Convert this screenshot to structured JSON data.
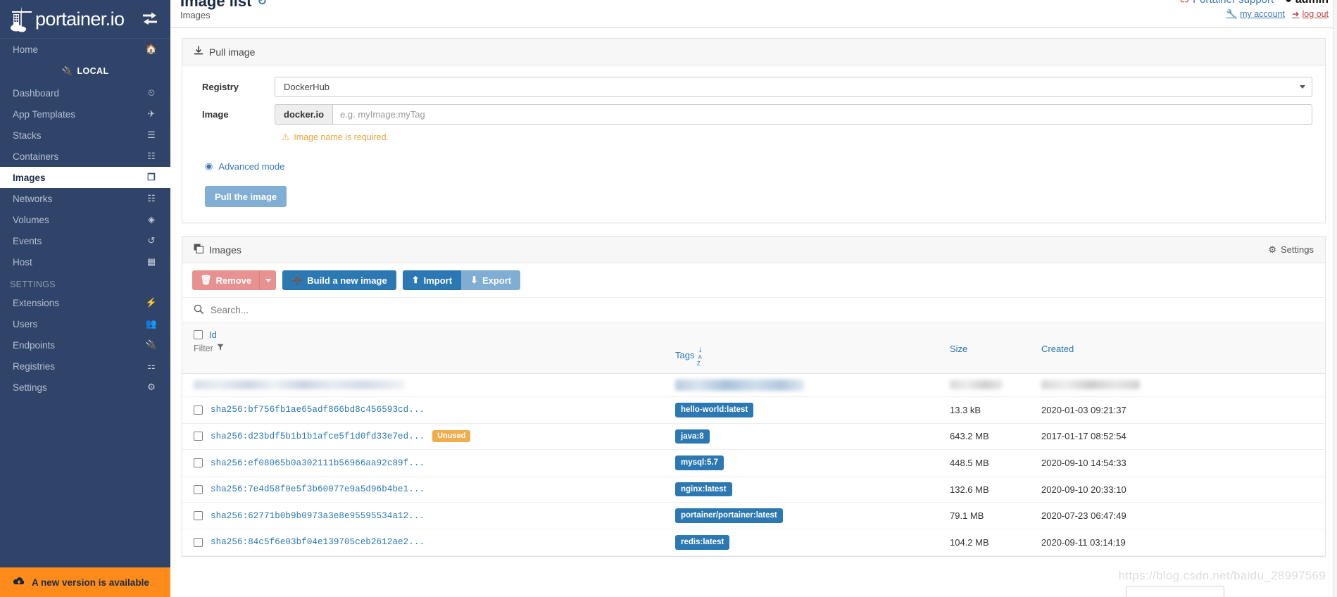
{
  "sidebar": {
    "brand": "portainer.io",
    "toggle_icon": "toggle-sidebar-icon",
    "home_label": "Home",
    "endpoint_label": "LOCAL",
    "settings_section_label": "SETTINGS",
    "items": [
      {
        "label": "Dashboard",
        "icon": "dashboard-icon"
      },
      {
        "label": "App Templates",
        "icon": "rocket-icon"
      },
      {
        "label": "Stacks",
        "icon": "list-icon"
      },
      {
        "label": "Containers",
        "icon": "server-icon"
      },
      {
        "label": "Images",
        "icon": "clone-icon"
      },
      {
        "label": "Networks",
        "icon": "sitemap-icon"
      },
      {
        "label": "Volumes",
        "icon": "cubes-icon"
      },
      {
        "label": "Events",
        "icon": "history-icon"
      },
      {
        "label": "Host",
        "icon": "th-icon"
      }
    ],
    "settings_items": [
      {
        "label": "Extensions",
        "icon": "bolt-icon"
      },
      {
        "label": "Users",
        "icon": "users-icon"
      },
      {
        "label": "Endpoints",
        "icon": "plug-icon"
      },
      {
        "label": "Registries",
        "icon": "database-icon"
      },
      {
        "label": "Settings",
        "icon": "cogs-icon"
      }
    ],
    "active_item": "Images",
    "new_version_label": "A new version is available"
  },
  "header": {
    "title": "Image list",
    "refresh_icon": "refresh-icon",
    "subtitle": "Images",
    "support_label": "Portainer support",
    "user_label": "admin",
    "my_account_label": "my account",
    "logout_label": "log out"
  },
  "pull_panel": {
    "title": "Pull image",
    "title_icon": "download-icon",
    "registry_label": "Registry",
    "registry_value": "DockerHub",
    "image_label": "Image",
    "image_prefix": "docker.io",
    "image_placeholder": "e.g. myImage:myTag",
    "image_value": "",
    "warning": "Image name is required.",
    "advanced_mode_label": "Advanced mode",
    "advanced_mode_icon": "globe-icon",
    "pull_button_label": "Pull the image"
  },
  "images_panel": {
    "title": "Images",
    "title_icon": "clone-icon",
    "settings_label": "Settings",
    "settings_icon": "gear-icon",
    "toolbar": {
      "remove_label": "Remove",
      "remove_icon": "trash-icon",
      "remove_caret_icon": "caret-down-icon",
      "build_label": "Build a new image",
      "build_icon": "plus-icon",
      "import_label": "Import",
      "import_icon": "upload-icon",
      "export_label": "Export",
      "export_icon": "download-icon"
    },
    "search_placeholder": "Search...",
    "search_value": "",
    "search_icon": "search-icon",
    "columns": {
      "id": "Id",
      "filter": "Filter",
      "filter_icon": "funnel-icon",
      "tags": "Tags",
      "tags_sort_icon": "sort-alpha-asc-icon",
      "size": "Size",
      "created": "Created"
    },
    "rows": [
      {
        "id": "",
        "blurred": true,
        "badge": "",
        "tag": "",
        "size": "",
        "created": ""
      },
      {
        "id": "sha256:bf756fb1ae65adf866bd8c456593cd...",
        "blurred": false,
        "badge": "",
        "tag": "hello-world:latest",
        "size": "13.3 kB",
        "created": "2020-01-03 09:21:37"
      },
      {
        "id": "sha256:d23bdf5b1b1b1afce5f1d0fd33e7ed...",
        "blurred": false,
        "badge": "Unused",
        "tag": "java:8",
        "size": "643.2 MB",
        "created": "2017-01-17 08:52:54"
      },
      {
        "id": "sha256:ef08065b0a302111b56966aa92c89f...",
        "blurred": false,
        "badge": "",
        "tag": "mysql:5.7",
        "size": "448.5 MB",
        "created": "2020-09-10 14:54:33"
      },
      {
        "id": "sha256:7e4d58f0e5f3b60077e9a5d96b4be1...",
        "blurred": false,
        "badge": "",
        "tag": "nginx:latest",
        "size": "132.6 MB",
        "created": "2020-09-10 20:33:10"
      },
      {
        "id": "sha256:62771b0b9b0973a3e8e95595534a12...",
        "blurred": false,
        "badge": "",
        "tag": "portainer/portainer:latest",
        "size": "79.1 MB",
        "created": "2020-07-23 06:47:49"
      },
      {
        "id": "sha256:84c5f6e03bf04e139705ceb2612ae2...",
        "blurred": false,
        "badge": "",
        "tag": "redis:latest",
        "size": "104.2 MB",
        "created": "2020-09-11 03:14:19"
      }
    ]
  },
  "watermark": "https://blog.csdn.net/baidu_28997569",
  "colors": {
    "sidebar_bg": "#2f4468",
    "accent_blue": "#2b78b3",
    "danger_red": "#e79290",
    "warning_orange": "#f0ad4e",
    "new_version_bg": "#ff8c1a"
  }
}
